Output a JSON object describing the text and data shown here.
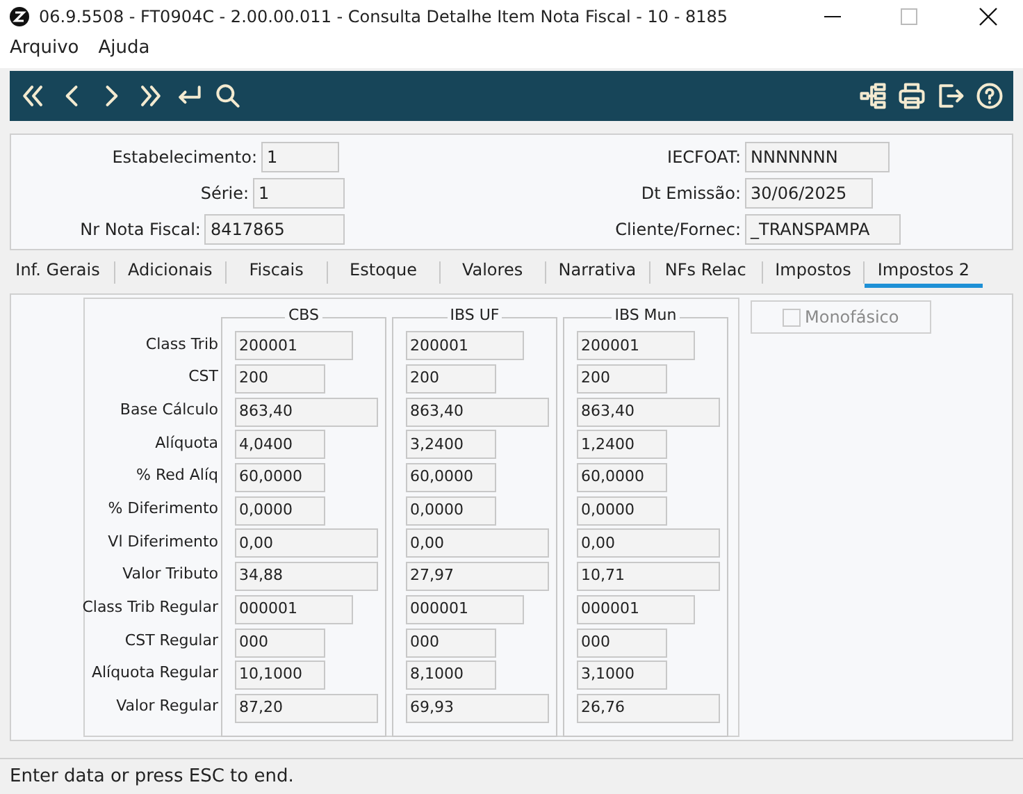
{
  "window": {
    "title": "06.9.5508 - FT0904C - 2.00.00.011 - Consulta Detalhe Item Nota Fiscal - 10 - 8185"
  },
  "menu": [
    "Arquivo",
    "Ajuda"
  ],
  "header_fields": [
    {
      "label": "Estabelecimento:",
      "value": "1"
    },
    {
      "label": "IECFOAT:",
      "value": "NNNNNNN"
    },
    {
      "label": "Série:",
      "value": "1"
    },
    {
      "label": "Dt Emissão:",
      "value": "30/06/2025"
    },
    {
      "label": "Nr Nota Fiscal:",
      "value": "8417865"
    },
    {
      "label": "Cliente/Fornec:",
      "value": "_TRANSPAMPA"
    }
  ],
  "tabs": [
    {
      "label": "Inf. Gerais",
      "selected": false
    },
    {
      "label": "Adicionais",
      "selected": false
    },
    {
      "label": "Fiscais",
      "selected": false
    },
    {
      "label": "Estoque",
      "selected": false
    },
    {
      "label": "Valores",
      "selected": false
    },
    {
      "label": "Narrativa",
      "selected": false
    },
    {
      "label": "NFs Relac",
      "selected": false
    },
    {
      "label": "Impostos",
      "selected": false
    },
    {
      "label": "Impostos 2",
      "selected": true
    }
  ],
  "row_labels": [
    "Class Trib",
    "CST",
    "Base Cálculo",
    "Alíquota",
    "% Red Alíq",
    "% Diferimento",
    "Vl Diferimento",
    "Valor Tributo",
    "Class Trib Regular",
    "CST Regular",
    "Alíquota Regular",
    "Valor Regular"
  ],
  "groups": [
    {
      "title": "CBS",
      "values": [
        "200001",
        "200",
        "863,40",
        "4,0400",
        "60,0000",
        "0,0000",
        "0,00",
        "34,88",
        "000001",
        "000",
        "10,1000",
        "87,20"
      ]
    },
    {
      "title": "IBS UF",
      "values": [
        "200001",
        "200",
        "863,40",
        "3,2400",
        "60,0000",
        "0,0000",
        "0,00",
        "27,97",
        "000001",
        "000",
        "8,1000",
        "69,93"
      ]
    },
    {
      "title": "IBS Mun",
      "values": [
        "200001",
        "200",
        "863,40",
        "1,2400",
        "60,0000",
        "0,0000",
        "0,00",
        "10,71",
        "000001",
        "000",
        "3,1000",
        "26,76"
      ]
    }
  ],
  "monofasico": {
    "label": "Monofásico",
    "checked": false,
    "disabled": true
  },
  "status_bar": "Enter data or press ESC to end."
}
